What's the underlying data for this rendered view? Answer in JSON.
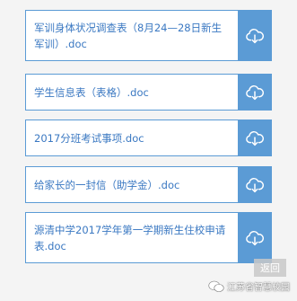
{
  "files": [
    {
      "name": "军训身体状况调查表（8月24—28日新生军训）.doc"
    },
    {
      "name": "学生信息表（表格）.doc"
    },
    {
      "name": "2017分班考试事项.doc"
    },
    {
      "name": "给家长的一封信（助学金）.doc"
    },
    {
      "name": "源清中学2017学年第一学期新生住校申请表.doc"
    }
  ],
  "back_label": "返回",
  "watermark": {
    "text": "江苏省智慧校园"
  },
  "colors": {
    "accent": "#5b9bd5",
    "link_text": "#3a78c2",
    "background": "#f4f4f4"
  },
  "icons": {
    "download": "cloud-download-icon",
    "wechat": "wechat-icon"
  }
}
